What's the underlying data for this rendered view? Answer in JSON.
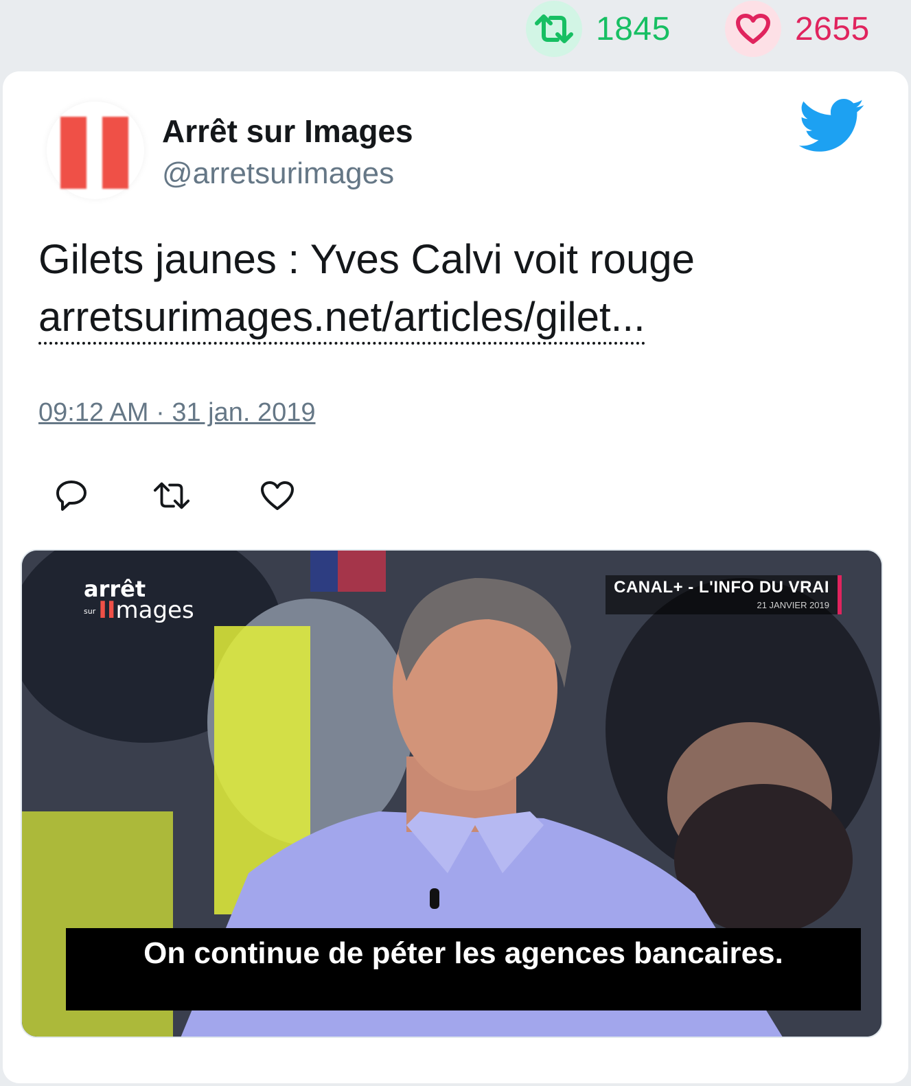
{
  "stats": {
    "retweets": "1845",
    "likes": "2655",
    "retweet_color": "#17bf63",
    "like_color": "#e0245e",
    "retweet_icon": "retweet-icon",
    "like_icon": "heart-icon"
  },
  "author": {
    "name": "Arrêt sur Images",
    "handle": "@arretsurimages",
    "avatar_colors": "#ef5047"
  },
  "brand_icon": "twitter-bird-icon",
  "brand_color": "#1da1f2",
  "tweet": {
    "text": "Gilets jaunes : Yves Calvi voit rouge",
    "link": "arretsurimages.net/articles/gilet...",
    "timestamp": "09:12 AM · 31 jan. 2019"
  },
  "actions": {
    "reply_icon": "reply-icon",
    "retweet_icon": "retweet-icon",
    "like_icon": "heart-outline-icon"
  },
  "media": {
    "watermark_line1": "arrêt",
    "watermark_sur": "sur",
    "watermark_line2_mark": "II",
    "watermark_line2": "mages",
    "channel": "CANAL+ - L'INFO DU VRAI",
    "channel_date": "21 JANVIER 2019",
    "subtitle": "On continue de péter les agences bancaires."
  }
}
